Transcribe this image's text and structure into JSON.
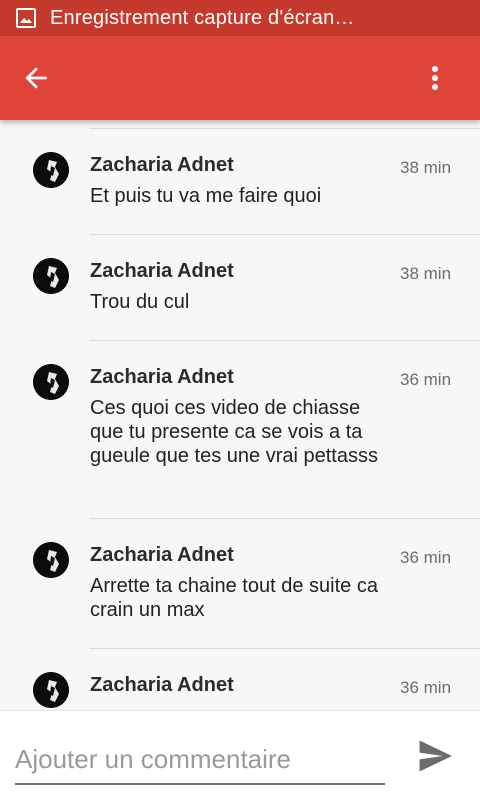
{
  "status_bar": {
    "title": "Enregistrement capture d'écran…",
    "icon": "image-icon"
  },
  "app_bar": {
    "back_icon": "arrow-back-icon",
    "menu_icon": "more-vert-icon",
    "color": "#de4437"
  },
  "comments": [
    {
      "author": "Zacharia Adnet",
      "time": "38 min",
      "text": "Et puis tu va me faire quoi"
    },
    {
      "author": "Zacharia Adnet",
      "time": "38 min",
      "text": "Trou du cul"
    },
    {
      "author": "Zacharia Adnet",
      "time": "36 min",
      "text": "Ces quoi ces video de chiasse que tu presente ca se vois a ta gueule que tes une vrai pettasss"
    },
    {
      "author": "Zacharia Adnet",
      "time": "36 min",
      "text": "Arrette ta chaine tout de suite ca crain un max"
    },
    {
      "author": "Zacharia Adnet",
      "time": "36 min",
      "text": ""
    }
  ],
  "composer": {
    "placeholder": "Ajouter un commentaire",
    "value": "",
    "send_icon": "send-icon"
  }
}
